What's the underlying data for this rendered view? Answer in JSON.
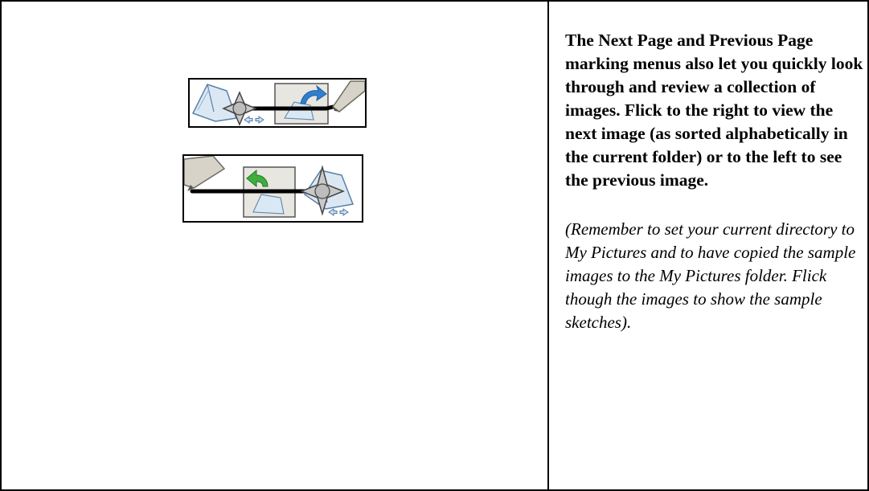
{
  "description_text": "The Next Page and Previous Page marking menus also let you quickly look through and review a collection of images. Flick to the right to view the next image (as sorted alphabetically in the current folder) or to the left to see the previous image.",
  "note_text": "(Remember to set your current directory to My Pictures and to have copied the sample images to the My Pictures folder. Flick though the images to show the sample sketches).",
  "menus": {
    "next": {
      "icon": "next-page-arrow-icon",
      "direction": "right"
    },
    "previous": {
      "icon": "previous-page-arrow-icon",
      "direction": "left"
    }
  },
  "colors": {
    "next_arrow": "#2f7fd0",
    "previous_arrow": "#3fae3f",
    "page_fill": "#d9e8f5",
    "menu_box_fill": "#e8e6e0",
    "pen_fill": "#d8d3c8"
  }
}
